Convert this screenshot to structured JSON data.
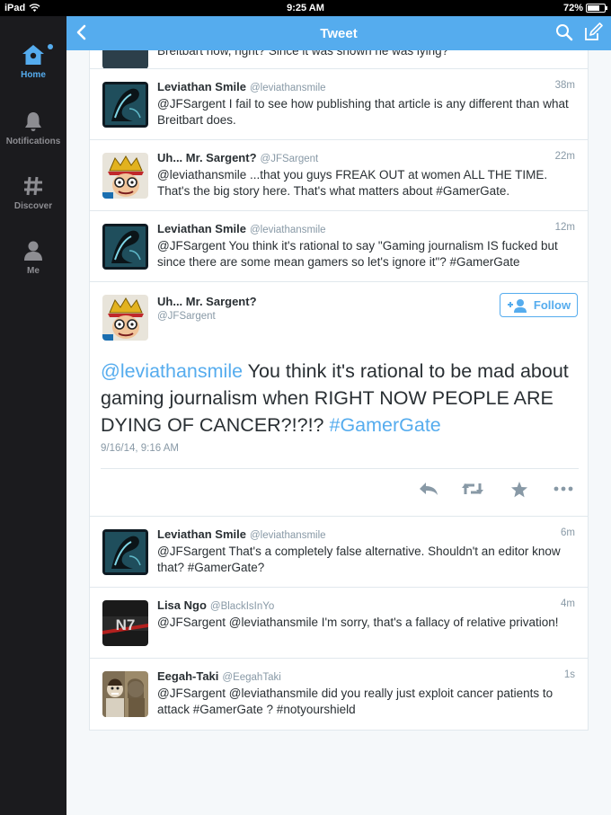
{
  "status_bar": {
    "device": "iPad",
    "time": "9:25 AM",
    "battery": "72%",
    "battery_level": 0.72
  },
  "sidebar": {
    "items": [
      {
        "label": "Home",
        "icon": "home-icon",
        "active": true
      },
      {
        "label": "Notifications",
        "icon": "bell-icon",
        "active": false
      },
      {
        "label": "Discover",
        "icon": "hashtag-icon",
        "active": false
      },
      {
        "label": "Me",
        "icon": "person-icon",
        "active": false
      }
    ]
  },
  "header": {
    "title": "Tweet",
    "back_icon": "chevron-left-icon",
    "search_icon": "search-icon",
    "compose_icon": "compose-icon"
  },
  "partial_tweet": {
    "text": "Breitbart how, right? Since it was shown he was lying?"
  },
  "tweets_before": [
    {
      "name": "Leviathan Smile",
      "handle": "@leviathansmile",
      "time": "38m",
      "text": "@JFSargent I fail to see how publishing that article is any different than what Breitbart does.",
      "avatar": "leviathan"
    },
    {
      "name": "Uh... Mr. Sargent?",
      "handle": "@JFSargent",
      "time": "22m",
      "text": "@leviathansmile ...that you guys FREAK OUT at women ALL THE TIME. That's the big story here. That's what matters about #GamerGate.",
      "avatar": "sargent"
    },
    {
      "name": "Leviathan Smile",
      "handle": "@leviathansmile",
      "time": "12m",
      "text": "@JFSargent You think it's rational to say \"Gaming journalism IS fucked but since there are some mean gamers so let's ignore it\"? #GamerGate",
      "avatar": "leviathan"
    }
  ],
  "main_tweet": {
    "name": "Uh... Mr. Sargent?",
    "handle": "@JFSargent",
    "follow_label": "Follow",
    "mention": "@leviathansmile",
    "body": " You think it's rational to be mad about gaming journalism when RIGHT NOW PEOPLE ARE DYING OF CANCER?!?!? ",
    "hashtag": "#GamerGate",
    "timestamp": "9/16/14, 9:16 AM",
    "actions": [
      "reply-icon",
      "retweet-icon",
      "star-icon",
      "more-icon"
    ]
  },
  "tweets_after": [
    {
      "name": "Leviathan Smile",
      "handle": "@leviathansmile",
      "time": "6m",
      "text": "@JFSargent That's a completely false alternative. Shouldn't an editor know that? #GamerGate?",
      "avatar": "leviathan"
    },
    {
      "name": "Lisa Ngo",
      "handle": "@BlackIsInYo",
      "time": "4m",
      "text": "@JFSargent @leviathansmile I'm sorry, that's a fallacy of relative privation!",
      "avatar": "n7",
      "avatar_text": "N7"
    },
    {
      "name": "Eegah-Taki",
      "handle": "@EegahTaki",
      "time": "1s",
      "text": "@JFSargent @leviathansmile did you really just exploit cancer patients to attack #GamerGate ? #notyourshield",
      "avatar": "eegah"
    }
  ],
  "colors": {
    "accent": "#55acee",
    "sidebar": "#1b1b1e",
    "text": "#292f33",
    "muted": "#8899a6"
  }
}
